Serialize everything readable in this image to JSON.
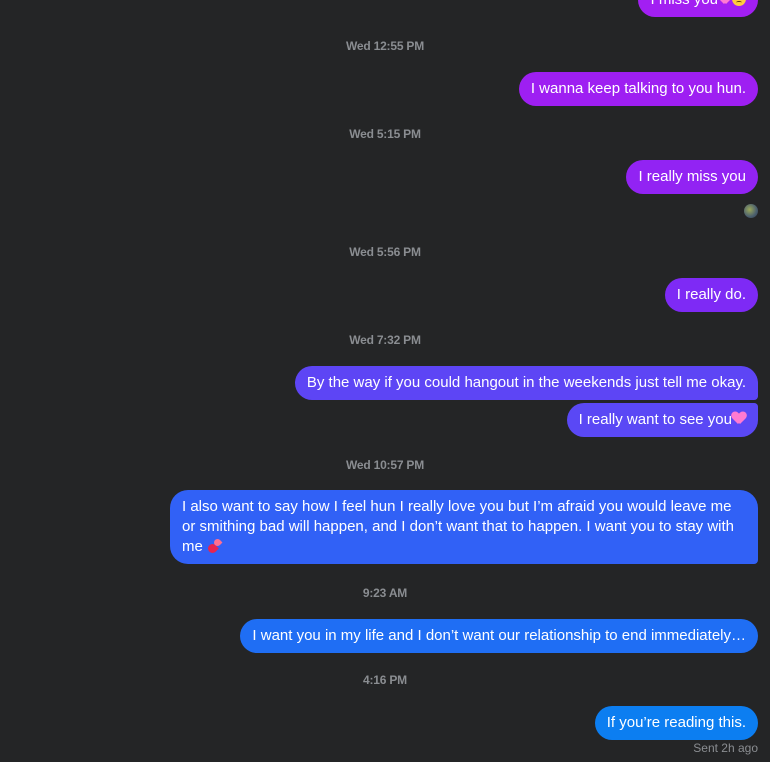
{
  "colors": {
    "background": "#242526",
    "timestamp": "#8a8d91",
    "bubble_gradient": [
      "#a21ff2",
      "#9723f3",
      "#8127f5",
      "#6a3bf5",
      "#4f4cf5",
      "#3a5cf7",
      "#2a6af7",
      "#1a73f3",
      "#0c7ef1"
    ]
  },
  "messages": [
    {
      "type": "bubble",
      "text": "I miss you",
      "emoji": [
        "pink-heart-emoji",
        "sad-face-emoji"
      ]
    },
    {
      "type": "time",
      "text": "Wed 12:55 PM"
    },
    {
      "type": "bubble",
      "text": "I wanna keep talking to you hun."
    },
    {
      "type": "time",
      "text": "Wed 5:15 PM"
    },
    {
      "type": "bubble",
      "text": "I really miss you"
    },
    {
      "type": "time",
      "text": "Wed 5:56 PM"
    },
    {
      "type": "bubble",
      "text": "I really do."
    },
    {
      "type": "time",
      "text": "Wed 7:32 PM"
    },
    {
      "type": "bubble",
      "text": "By the way if you could hangout in the weekends just tell me okay."
    },
    {
      "type": "bubble",
      "text": "I really want to see you",
      "emoji": [
        "pink-heart-emoji"
      ]
    },
    {
      "type": "time",
      "text": "Wed 10:57 PM"
    },
    {
      "type": "bubble",
      "text": "I also want to say how I feel hun I really love you but I’m afraid you would leave me or smithing bad will happen, and I don’t want that to happen. I want you to stay with me",
      "emoji": [
        "two-hearts-emoji"
      ]
    },
    {
      "type": "time",
      "text": "9:23 AM"
    },
    {
      "type": "bubble",
      "text": "I want you in my life and I don’t want our relationship to end immediately…"
    },
    {
      "type": "time",
      "text": "4:16 PM"
    },
    {
      "type": "bubble",
      "text": "If you’re reading this."
    }
  ],
  "status": "Sent 2h ago",
  "seen_avatar_icon": "seen-avatar-icon"
}
